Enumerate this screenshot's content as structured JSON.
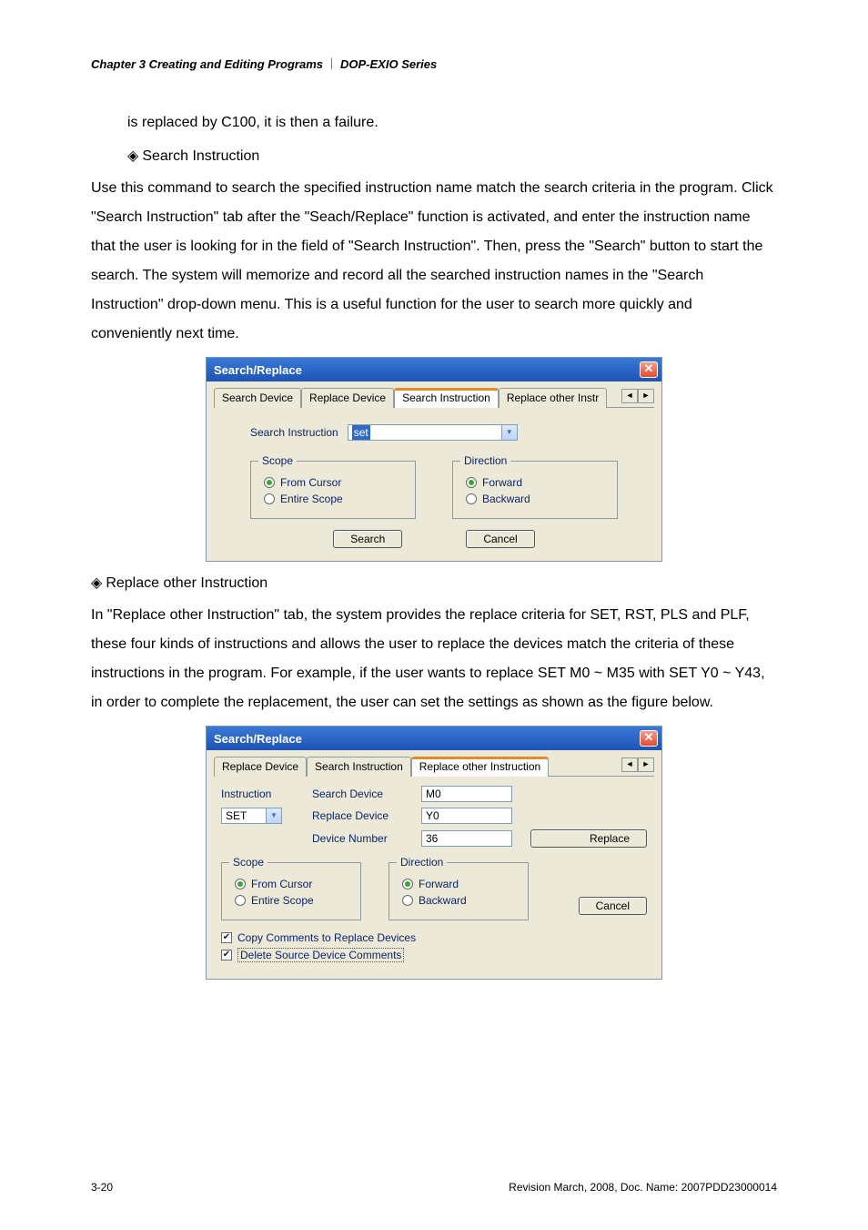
{
  "header": {
    "chapter": "Chapter 3 Creating and Editing Programs",
    "separator": "｜",
    "series": "DOP-EXIO Series"
  },
  "para1": "is replaced by C100, it is then a failure.",
  "heading1": "Search Instruction",
  "para2": "Use this command to search the specified instruction name match the search criteria in the program. Click \"Search Instruction\" tab after the \"Seach/Replace\" function is activated, and enter the instruction name that the user is looking for in the field of \"Search Instruction\". Then, press the \"Search\" button to start the search. The system will memorize and record all the searched instruction names in the \"Search Instruction\" drop-down menu. This is a useful function for the user to search more quickly and conveniently next time.",
  "dialog1": {
    "title": "Search/Replace",
    "tabs": {
      "t1": "Search Device",
      "t2": "Replace Device",
      "t3": "Search Instruction",
      "t4": "Replace other Instr"
    },
    "scroll_left": "◄",
    "scroll_right": "►",
    "field_label": "Search Instruction",
    "field_value": "set",
    "scope_legend": "Scope",
    "scope_from": "From Cursor",
    "scope_entire": "Entire Scope",
    "dir_legend": "Direction",
    "dir_fwd": "Forward",
    "dir_bwd": "Backward",
    "btn_search": "Search",
    "btn_cancel": "Cancel"
  },
  "heading2": "Replace other Instruction",
  "para3": "In \"Replace other Instruction\" tab, the system provides the replace criteria for SET, RST, PLS and PLF, these four kinds of instructions and allows the user to replace the devices match the criteria of these instructions in the program. For example, if the user wants to replace SET M0 ~ M35 with SET Y0 ~ Y43, in order to complete the replacement, the user can set the settings as shown as the figure below.",
  "dialog2": {
    "title": "Search/Replace",
    "tabs": {
      "t1": "Replace Device",
      "t2": "Search Instruction",
      "t3": "Replace other Instruction"
    },
    "scroll_left": "◄",
    "scroll_right": "►",
    "instr_label": "Instruction",
    "instr_value": "SET",
    "sdev_label": "Search Device",
    "sdev_value": "M0",
    "rdev_label": "Replace Device",
    "rdev_value": "Y0",
    "dnum_label": "Device Number",
    "dnum_value": "36",
    "btn_replace": "Replace",
    "scope_legend": "Scope",
    "scope_from": "From Cursor",
    "scope_entire": "Entire Scope",
    "dir_legend": "Direction",
    "dir_fwd": "Forward",
    "dir_bwd": "Backward",
    "btn_cancel": "Cancel",
    "chk1": "Copy Comments to Replace Devices",
    "chk2": "Delete Source Device Comments"
  },
  "footer": {
    "page": "3-20",
    "rev": "Revision March, 2008, Doc. Name: 2007PDD23000014"
  },
  "icons": {
    "close_x": "✕",
    "diamond": "◈",
    "check": "✔",
    "dd": "▼"
  }
}
